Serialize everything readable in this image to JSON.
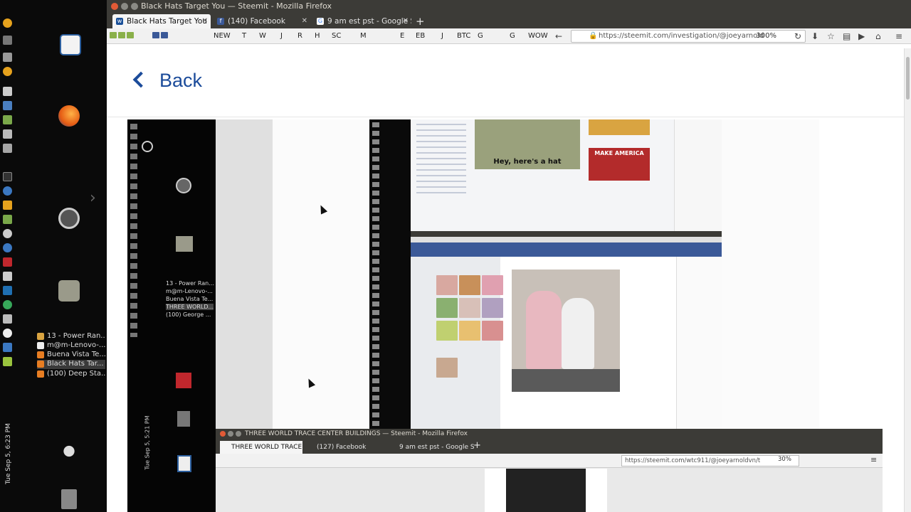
{
  "dock": {
    "tasks": [
      {
        "label": "13 - Power Ran...",
        "color": "#d9a441"
      },
      {
        "label": "m@m-Lenovo-...",
        "color": "#eee"
      },
      {
        "label": "Buena Vista Te...",
        "color": "#e77d22"
      },
      {
        "label": "Black Hats Tar...",
        "color": "#e77d22",
        "active": true
      },
      {
        "label": "(100) Deep Sta...",
        "color": "#e77d22"
      }
    ],
    "clock": "Tue Sep 5, 6:23 PM"
  },
  "window": {
    "title": "Black Hats Target You — Steemit - Mozilla Firefox",
    "tabs": [
      {
        "label": "Black Hats Target You",
        "icon": "steemit-icon",
        "active": true
      },
      {
        "label": "(140) Facebook",
        "icon": "facebook-icon"
      },
      {
        "label": "9 am est pst - Google S",
        "icon": "google-icon"
      }
    ],
    "bookmarks": [
      "NEW",
      "T",
      "W",
      "J",
      "R",
      "H",
      "SC",
      "M",
      "E",
      "EB",
      "J",
      "BTC",
      "G",
      "G",
      "WOW"
    ],
    "url": "https://steemit.com/investigation/@joeyarnold",
    "zoom": "300%"
  },
  "page": {
    "back_label": "Back"
  },
  "embedded": {
    "tasks": [
      "13 - Power Ran...",
      "m@m-Lenovo-...",
      "Buena Vista Te...",
      "THREE WORLD...",
      "(100) George ..."
    ],
    "clock": "Tue Sep 5, 5:21 PM",
    "meme_text": "Hey, here's a hat",
    "maga_text": "MAKE AMERICA"
  },
  "window2": {
    "title": "THREE WORLD TRACE CENTER BUILDINGS — Steemit - Mozilla Firefox",
    "tabs": [
      "THREE WORLD TRACE",
      "(127) Facebook",
      "9 am est pst - Google S"
    ],
    "url": "https://steemit.com/wtc911/@joeyarnoldvn/t",
    "zoom": "30%"
  }
}
